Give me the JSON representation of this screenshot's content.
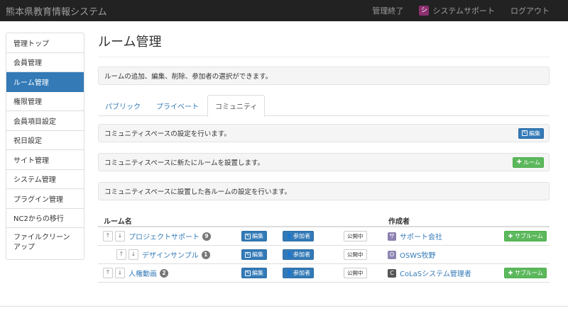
{
  "brand": "熊本県教育情報システム",
  "nav": {
    "end_admin": "管理終了",
    "support_logo": "シ",
    "system_support": "システムサポート",
    "logout": "ログアウト"
  },
  "sidebar": {
    "items": [
      {
        "label": "管理トップ"
      },
      {
        "label": "会員管理"
      },
      {
        "label": "ルーム管理"
      },
      {
        "label": "権限管理"
      },
      {
        "label": "会員項目設定"
      },
      {
        "label": "祝日設定"
      },
      {
        "label": "サイト管理"
      },
      {
        "label": "システム管理"
      },
      {
        "label": "プラグイン管理"
      },
      {
        "label": "NC2からの移行"
      },
      {
        "label": "ファイルクリーンアップ"
      }
    ]
  },
  "main": {
    "title": "ルーム管理",
    "description": "ルームの追加、編集、削除、参加者の選択ができます。",
    "tabs": [
      {
        "label": "パブリック"
      },
      {
        "label": "プライベート"
      },
      {
        "label": "コミュニティ"
      }
    ],
    "panels": {
      "space_settings": "コミュニティスペースの設定を行います。",
      "new_room": "コミュニティスペースに新たにルームを設置します。",
      "room_settings": "コミュニティスペースに設置した各ルームの設定を行います。"
    },
    "buttons": {
      "edit": "編集",
      "add_room": "ルーム",
      "members": "参加者",
      "sub_room": "サブルーム"
    },
    "table": {
      "headers": {
        "room_name": "ルーム名",
        "creator": "作成者"
      },
      "rows": [
        {
          "name": "プロジェクトサポート",
          "count": "9",
          "status": "公開中",
          "creator": "サポート会社",
          "avatar": "サ",
          "avatar_color": "#8a7fb0"
        },
        {
          "name": "デザインサンプル",
          "count": "1",
          "status": "公開中",
          "creator": "OSWS牧野",
          "avatar": "O",
          "avatar_color": "#8f86b3"
        },
        {
          "name": "人権動画",
          "count": "2",
          "status": "公開中",
          "creator": "CoLaSシステム管理者",
          "avatar": "C",
          "avatar_color": "#555555"
        }
      ]
    }
  },
  "colors": {
    "primary": "#337ab7",
    "success": "#5cb85c",
    "navbar": "#222222"
  }
}
